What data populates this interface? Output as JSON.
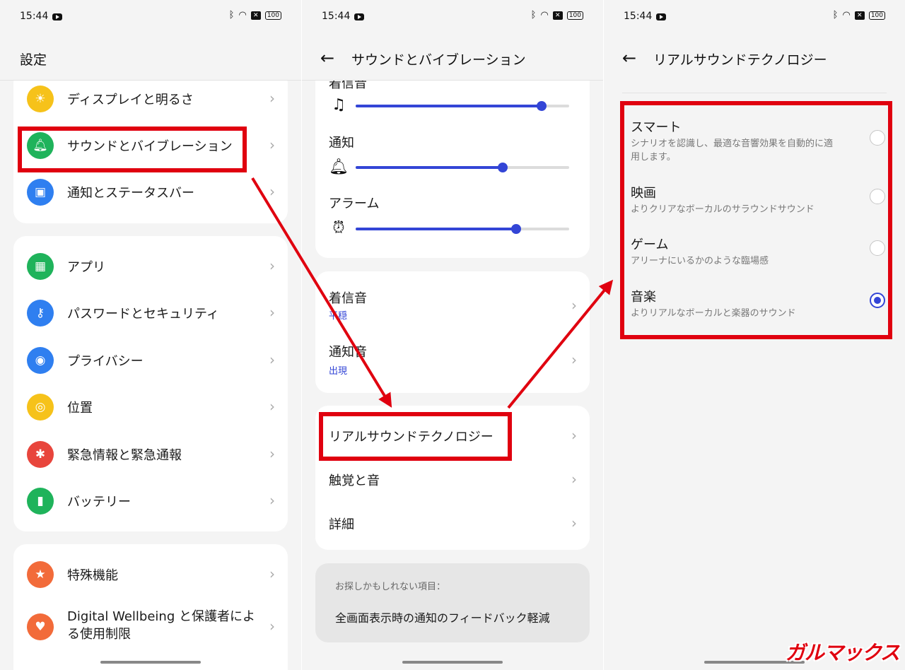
{
  "status": {
    "time": "15:44",
    "battery": "100",
    "x_badge": "✕"
  },
  "screen1": {
    "title": "設定",
    "groups": [
      [
        {
          "label": "ディスプレイと明るさ",
          "icon": "sun-icon",
          "color": "#f6c21a"
        },
        {
          "label": "サウンドとバイブレーション",
          "icon": "bell-icon",
          "color": "#1fb35b"
        },
        {
          "label": "通知とステータスバー",
          "icon": "notification-icon",
          "color": "#2f7ff0"
        }
      ],
      [
        {
          "label": "アプリ",
          "icon": "apps-grid-icon",
          "color": "#1fb35b"
        },
        {
          "label": "パスワードとセキュリティ",
          "icon": "key-icon",
          "color": "#2f7ff0"
        },
        {
          "label": "プライバシー",
          "icon": "eye-lock-icon",
          "color": "#2f7ff0"
        },
        {
          "label": "位置",
          "icon": "location-icon",
          "color": "#f6c21a"
        },
        {
          "label": "緊急情報と緊急通報",
          "icon": "asterisk-icon",
          "color": "#e8453c"
        },
        {
          "label": "バッテリー",
          "icon": "battery-icon",
          "color": "#1fb35b"
        }
      ],
      [
        {
          "label": "特殊機能",
          "icon": "star-icon",
          "color": "#f26b3a"
        },
        {
          "label": "Digital Wellbeing と保護者による使用制限",
          "icon": "heart-person-icon",
          "color": "#f26b3a"
        }
      ]
    ]
  },
  "screen2": {
    "title": "サウンドとバイブレーション",
    "cut_label": "着信音",
    "sliders": [
      {
        "label": "",
        "icon": "ringtone-icon",
        "level": 0.87
      },
      {
        "label": "通知",
        "icon": "bell-icon",
        "level": 0.69
      },
      {
        "label": "アラーム",
        "icon": "alarm-icon",
        "level": 0.75
      }
    ],
    "tones": [
      {
        "title": "着信音",
        "value": "平穏"
      },
      {
        "title": "通知音",
        "value": "出現"
      }
    ],
    "more": [
      "リアルサウンドテクノロジー",
      "触覚と音",
      "詳細"
    ],
    "suggest": {
      "caption": "お探しかもしれない項目：",
      "item": "全画面表示時の通知のフィードバック軽減"
    }
  },
  "screen3": {
    "title": "リアルサウンドテクノロジー",
    "options": [
      {
        "title": "スマート",
        "desc": "シナリオを認識し、最適な音響効果を自動的に適用します。",
        "selected": false
      },
      {
        "title": "映画",
        "desc": "よりクリアなボーカルのサラウンドサウンド",
        "selected": false
      },
      {
        "title": "ゲーム",
        "desc": "アリーナにいるかのような臨場感",
        "selected": false
      },
      {
        "title": "音楽",
        "desc": "よりリアルなボーカルと楽器のサウンド",
        "selected": true
      }
    ]
  },
  "colors": {
    "accent": "#3345d6",
    "highlight": "#e0000f"
  },
  "watermark": "ガルマックス"
}
